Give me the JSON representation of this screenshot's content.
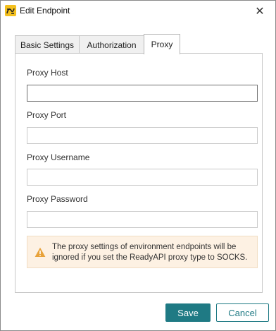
{
  "window": {
    "title": "Edit Endpoint",
    "close_glyph": "✕",
    "app_icon": "readyapi-logo-icon"
  },
  "tabs": [
    {
      "label": "Basic Settings",
      "active": false
    },
    {
      "label": "Authorization",
      "active": false
    },
    {
      "label": "Proxy",
      "active": true
    }
  ],
  "form": {
    "proxy_host": {
      "label": "Proxy Host",
      "value": "",
      "placeholder": ""
    },
    "proxy_port": {
      "label": "Proxy Port",
      "value": "",
      "placeholder": ""
    },
    "proxy_username": {
      "label": "Proxy Username",
      "value": "",
      "placeholder": ""
    },
    "proxy_password": {
      "label": "Proxy Password",
      "value": "",
      "placeholder": ""
    }
  },
  "warning": {
    "icon": "warning-icon",
    "text": "The proxy settings of environment endpoints will be ignored if you set the ReadyAPI proxy type to SOCKS."
  },
  "buttons": {
    "save": "Save",
    "cancel": "Cancel"
  },
  "colors": {
    "accent": "#1f7a84",
    "warning_bg": "#fdf1e3",
    "warning_icon": "#e8a23a"
  }
}
